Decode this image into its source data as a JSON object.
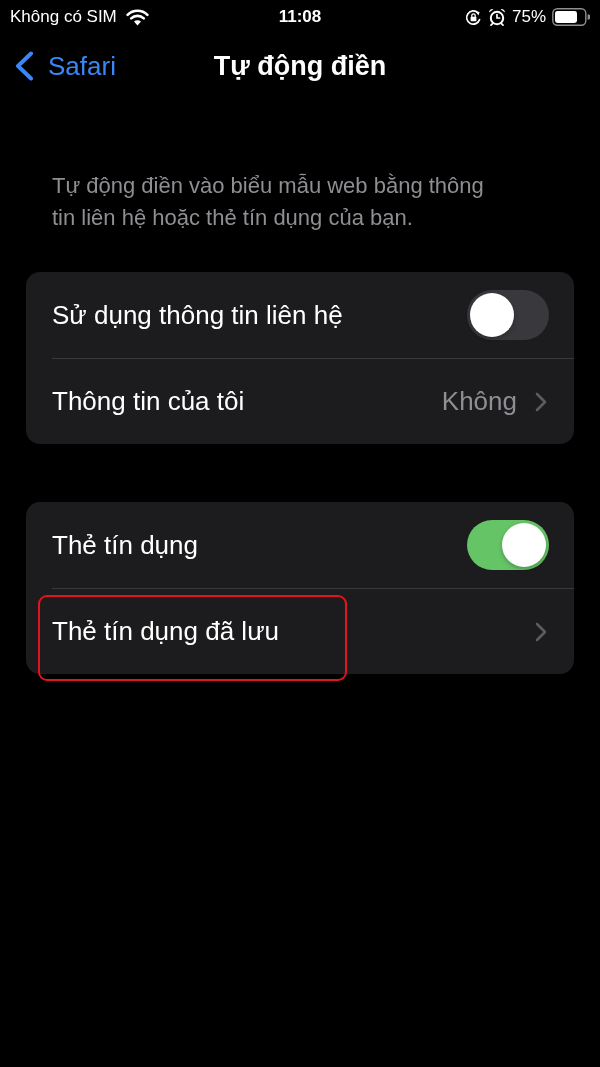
{
  "status_bar": {
    "carrier": "Không có SIM",
    "time": "11:08",
    "battery": "75%"
  },
  "nav_bar": {
    "back": "Safari",
    "title": "Tự động điền"
  },
  "description": "Tự động điền vào biểu mẫu web bằng thông tin liên hệ hoặc thẻ tín dụng của bạn.",
  "groups": [
    {
      "rows": [
        {
          "kind": "toggle",
          "label": "Sử dụng thông tin liên hệ",
          "on": false,
          "highlighted": false
        },
        {
          "kind": "link",
          "label": "Thông tin của tôi",
          "value": "Không",
          "highlighted": false
        }
      ]
    },
    {
      "rows": [
        {
          "kind": "toggle",
          "label": "Thẻ tín dụng",
          "on": true,
          "highlighted": false
        },
        {
          "kind": "link",
          "label": "Thẻ tín dụng đã lưu",
          "highlighted": true
        }
      ]
    }
  ]
}
